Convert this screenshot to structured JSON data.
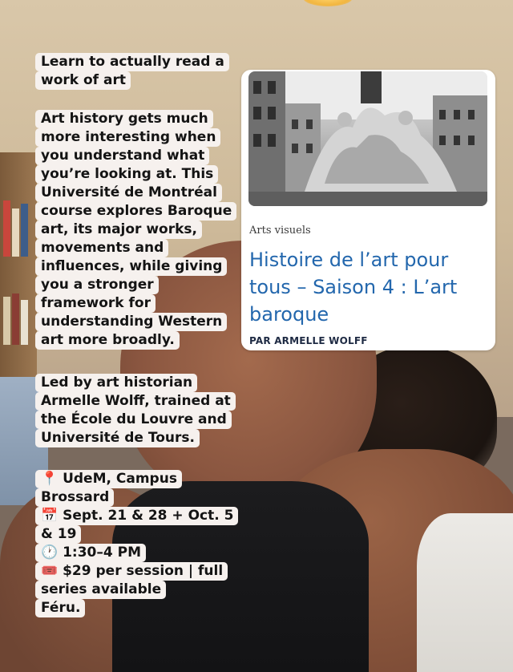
{
  "caption": {
    "headline": "Learn to actually read a work of art",
    "intro": "Art history gets much more interesting when you understand what you’re looking at. This Université de Montréal course explores Baroque art, its major works, movements and influences, while giving you a stronger framework for understanding Western art more broadly.",
    "instructor": "Led by art historian Armelle Wolff, trained at the École du Louvre and Université de Tours.",
    "location": "📍 UdeM, Campus Brossard",
    "dates": "📅 Sept. 21 & 28 + Oct. 5 & 19",
    "time": "🕐 1:30–4 PM",
    "price": "🎟️ $29 per session | full series available",
    "signoff": "Féru."
  },
  "card": {
    "category": "Arts visuels",
    "title": "Histoire de l’art pour tous – Saison 4 : L’art baroque",
    "author": "PAR ARMELLE WOLFF",
    "photo_icon": "baroque-fountain-photo"
  }
}
